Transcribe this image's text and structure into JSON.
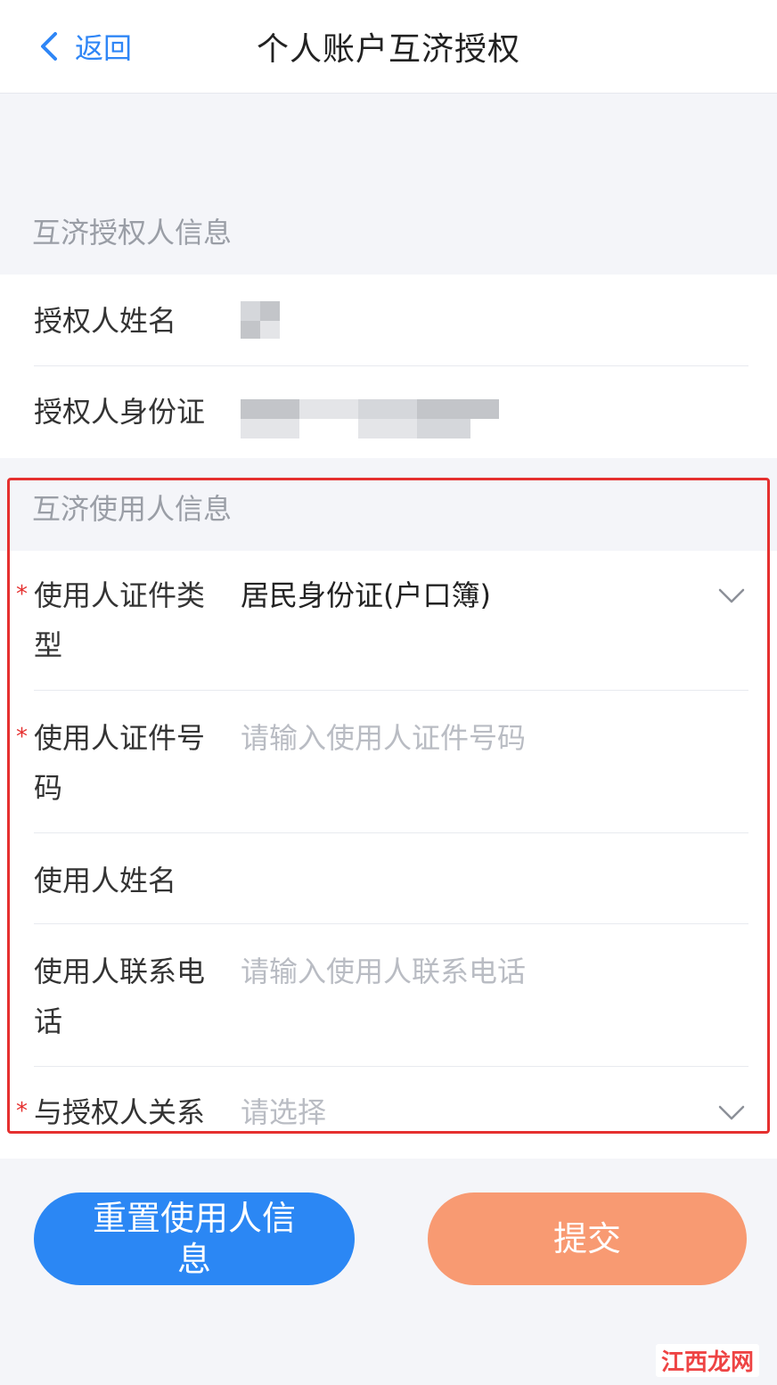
{
  "header": {
    "back_label": "返回",
    "title": "个人账户互济授权"
  },
  "grantor_section": {
    "title": "互济授权人信息",
    "name_label": "授权人姓名",
    "id_label": "授权人身份证"
  },
  "user_section": {
    "title": "互济使用人信息",
    "id_type_label_line1": "使用人证件类",
    "id_type_label_line2": "型",
    "id_type_value": "居民身份证(户口簿)",
    "id_number_label_line1": "使用人证件号",
    "id_number_label_line2": "码",
    "id_number_placeholder": "请输入使用人证件号码",
    "name_label": "使用人姓名",
    "phone_label_line1": "使用人联系电",
    "phone_label_line2": "话",
    "phone_placeholder": "请输入使用人联系电话",
    "relation_label": "与授权人关系",
    "relation_placeholder": "请选择",
    "required_mark": "*"
  },
  "buttons": {
    "reset_line1": "重置使用人信",
    "reset_line2": "息",
    "submit": "提交"
  },
  "watermark": "江西龙网",
  "colors": {
    "accent_blue": "#2b87f4",
    "submit_orange": "#f89a72",
    "required_red": "#e5302f",
    "highlight_border": "#e5302f"
  }
}
